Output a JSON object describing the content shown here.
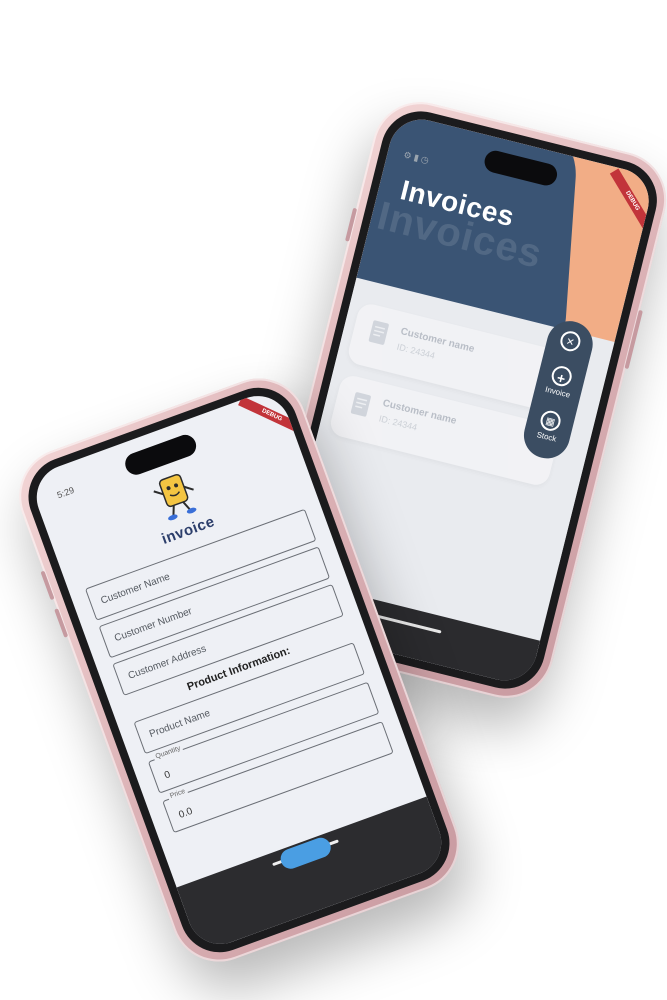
{
  "invoices_screen": {
    "title": "Invoices",
    "title_shadow": "Invoices",
    "debug_banner": "DEBUG",
    "items": [
      {
        "name": "Customer name",
        "id": "ID: 24344"
      },
      {
        "name": "Customer name",
        "id": "ID: 24344"
      }
    ],
    "fab_menu": {
      "close_icon": "✕",
      "invoice_icon": "+",
      "invoice_label": "Invoice",
      "stock_icon": "▦",
      "stock_label": "Stock"
    },
    "colors": {
      "hero_orange": "#f2ad86",
      "hero_blue": "#2f4f73",
      "fab": "#3b4d62"
    }
  },
  "form_screen": {
    "status_time": "5:29",
    "debug_banner": "DEBUG",
    "brand": "invoice",
    "fields": {
      "customer_name": "Customer Name",
      "customer_number": "Customer Number",
      "customer_address": "Customer Address",
      "product_name": "Product Name"
    },
    "section_title": "Product Information:",
    "quantity": {
      "label": "Quantity",
      "value": "0"
    },
    "price": {
      "label": "Price",
      "value": "0.0"
    },
    "colors": {
      "brand": "#2c3e6b",
      "button": "#4a9ee3"
    }
  }
}
